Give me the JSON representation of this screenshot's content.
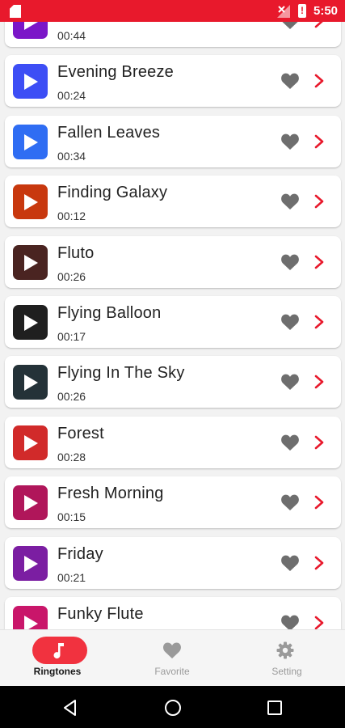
{
  "status_bar": {
    "time": "5:50"
  },
  "ringtones": [
    {
      "title": "",
      "duration": "00:44",
      "color": "#7b16c8"
    },
    {
      "title": "Evening Breeze",
      "duration": "00:24",
      "color": "#3d4ef5"
    },
    {
      "title": "Fallen Leaves",
      "duration": "00:34",
      "color": "#2f6df3"
    },
    {
      "title": "Finding Galaxy",
      "duration": "00:12",
      "color": "#c8380e"
    },
    {
      "title": "Fluto",
      "duration": "00:26",
      "color": "#4a2421"
    },
    {
      "title": "Flying Balloon",
      "duration": "00:17",
      "color": "#1f1f1f"
    },
    {
      "title": "Flying In The Sky",
      "duration": "00:26",
      "color": "#243238"
    },
    {
      "title": "Forest",
      "duration": "00:28",
      "color": "#d12a2a"
    },
    {
      "title": "Fresh Morning",
      "duration": "00:15",
      "color": "#b0165a"
    },
    {
      "title": "Friday",
      "duration": "00:21",
      "color": "#7b1ea2"
    },
    {
      "title": "Funky Flute",
      "duration": "",
      "color": "#c9166a"
    }
  ],
  "bottom_nav": {
    "items": [
      {
        "label": "Ringtones",
        "icon": "music-note-icon",
        "active": true
      },
      {
        "label": "Favorite",
        "icon": "heart-icon",
        "active": false
      },
      {
        "label": "Setting",
        "icon": "gear-icon",
        "active": false
      }
    ]
  },
  "colors": {
    "accent": "#e8192c",
    "heart": "#6e6e6e",
    "arrow": "#e8192c",
    "nav_inactive": "#9a9a9a"
  }
}
